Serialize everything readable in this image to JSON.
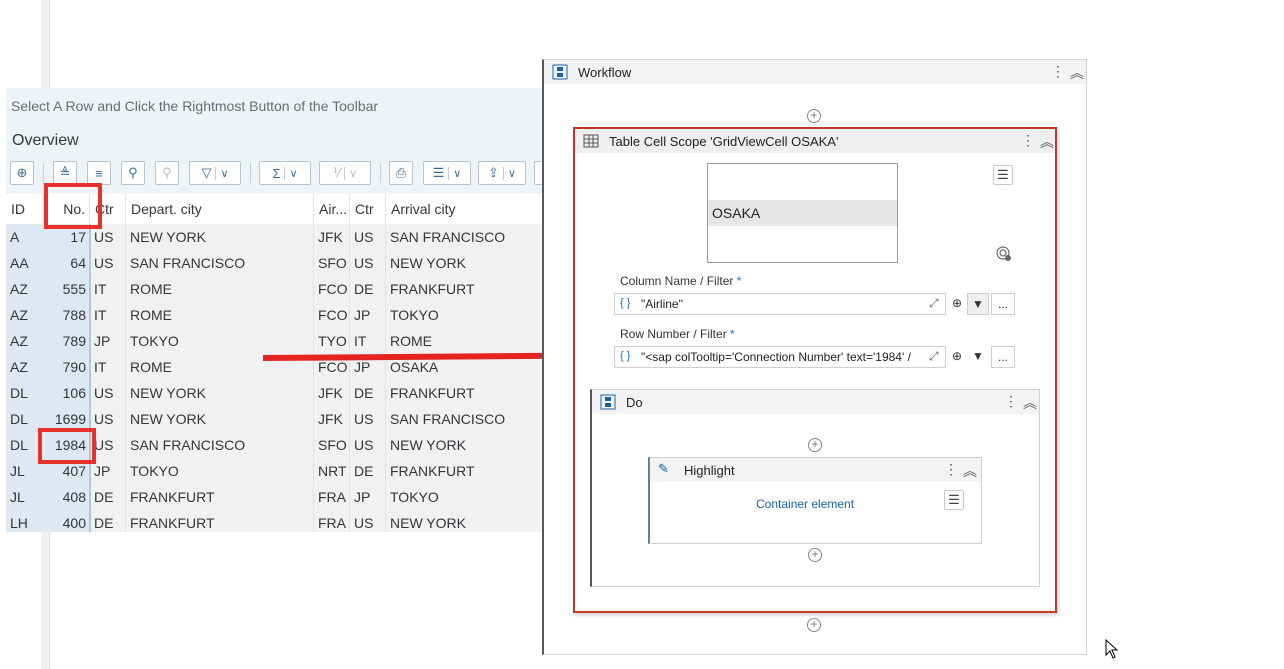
{
  "sap": {
    "instruction": "Select A Row and Click the Rightmost Button of the Toolbar",
    "title": "Overview",
    "columns": [
      "ID",
      "No.",
      "Ctr",
      "Depart. city",
      "Air...",
      "Ctr",
      "Arrival city"
    ],
    "rows": [
      [
        "A",
        "17",
        "US",
        "NEW YORK",
        "JFK",
        "US",
        "SAN FRANCISCO"
      ],
      [
        "AA",
        "64",
        "US",
        "SAN FRANCISCO",
        "SFO",
        "US",
        "NEW YORK"
      ],
      [
        "AZ",
        "555",
        "IT",
        "ROME",
        "FCO",
        "DE",
        "FRANKFURT"
      ],
      [
        "AZ",
        "788",
        "IT",
        "ROME",
        "FCO",
        "JP",
        "TOKYO"
      ],
      [
        "AZ",
        "789",
        "JP",
        "TOKYO",
        "TYO",
        "IT",
        "ROME"
      ],
      [
        "AZ",
        "790",
        "IT",
        "ROME",
        "FCO",
        "JP",
        "OSAKA"
      ],
      [
        "DL",
        "106",
        "US",
        "NEW YORK",
        "JFK",
        "DE",
        "FRANKFURT"
      ],
      [
        "DL",
        "1699",
        "US",
        "NEW YORK",
        "JFK",
        "US",
        "SAN FRANCISCO"
      ],
      [
        "DL",
        "1984",
        "US",
        "SAN FRANCISCO",
        "SFO",
        "US",
        "NEW YORK"
      ],
      [
        "JL",
        "407",
        "JP",
        "TOKYO",
        "NRT",
        "DE",
        "FRANKFURT"
      ],
      [
        "JL",
        "408",
        "DE",
        "FRANKFURT",
        "FRA",
        "JP",
        "TOKYO"
      ],
      [
        "LH",
        "400",
        "DE",
        "FRANKFURT",
        "FRA",
        "US",
        "NEW YORK"
      ]
    ],
    "toolbar_icons": [
      "zoom-icon",
      "sort-ascending-icon",
      "sort-descending-icon",
      "find-icon",
      "find-next-icon",
      "filter-icon",
      "sum-icon",
      "subtotal-icon",
      "print-icon",
      "view-icon",
      "export-icon",
      "layout-grid-icon"
    ],
    "toolbar_glyphs": {
      "zoom": "⊕",
      "sort_asc": "≜",
      "sort_desc": "≡",
      "find": "⚲",
      "find_next": "⚲",
      "filter": "▽",
      "sum": "Σ",
      "subtotal": "⅟",
      "print": "⎙",
      "view": "☰",
      "export": "⇪",
      "layout": "▦",
      "dropdown": "∨"
    }
  },
  "workflow": {
    "title": "Workflow",
    "table_cell_scope": {
      "title": "Table Cell Scope 'GridViewCell  OSAKA'",
      "preview_text": "OSAKA",
      "column_label": "Column Name / Filter",
      "column_value": "\"Airline\"",
      "row_label": "Row Number / Filter",
      "row_value": "\"<sap colTooltip='Connection Number' text='1984' /",
      "required_mark": "*",
      "brace": "{ }",
      "more": "..."
    },
    "do": {
      "title": "Do",
      "highlight": {
        "title": "Highlight",
        "link": "Container element"
      }
    }
  },
  "colors": {
    "accent_red": "#e52421",
    "scope_border": "#c0392b",
    "key_column": "#dde8f3"
  }
}
